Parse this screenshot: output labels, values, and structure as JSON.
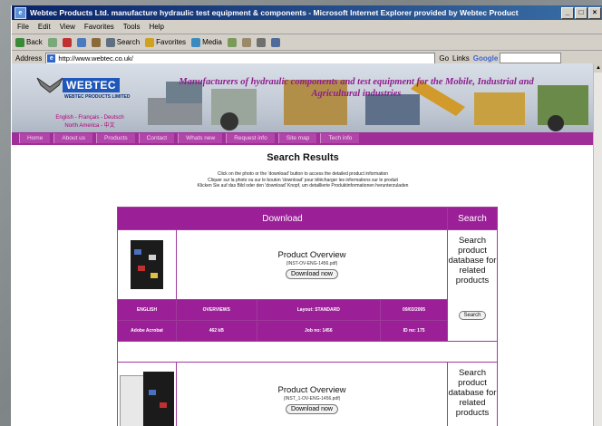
{
  "window": {
    "title": "Webtec Products Ltd. manufacture hydraulic test equipment & components - Microsoft Internet Explorer provided by Webtec Product"
  },
  "menu": [
    "File",
    "Edit",
    "View",
    "Favorites",
    "Tools",
    "Help"
  ],
  "toolbar": {
    "back": "Back",
    "search": "Search",
    "favorites": "Favorites",
    "media": "Media"
  },
  "address": {
    "label": "Address",
    "url": "http://www.webtec.co.uk/",
    "go": "Go",
    "links": "Links",
    "google": "Google"
  },
  "site": {
    "logo": "WEBTEC",
    "logo_sub": "WEBTEC PRODUCTS LIMITED",
    "languages": [
      "English - Français - Deutsch",
      "North America - 中文"
    ],
    "tagline": "Manufacturers of hydraulic components and test equipment for the Mobile, Industrial and Agricultural industries",
    "nav": [
      "Home",
      "About us",
      "Products",
      "Contact",
      "Whats new",
      "Request info",
      "Site map",
      "Tech info"
    ]
  },
  "results": {
    "heading": "Search Results",
    "instructions": [
      "Click on the photo or the 'download' button to access the detailed product information",
      "Cliquer sur la photo ou sur le bouton 'download' pour télécharger les informations sur le produit",
      "Klicken Sie auf das Bild oder den 'download' Knopf, um detaillierte Produktinformationen herunterzuladen"
    ],
    "col_download": "Download",
    "col_search": "Search",
    "search_text": "Search product database for related products",
    "search_button": "Search",
    "items": [
      {
        "title": "Product Overview",
        "code": "(INST-OV-ENG-1456.pdf)",
        "download": "Download now",
        "language": "ENGLISH",
        "category": "OVERVIEWS",
        "layout": "Layout: STANDARD",
        "date": "09/03/2005",
        "format": "Adobe Acrobat",
        "size": "462 kB",
        "job": "Job no: 1456",
        "id": "ID no: 175"
      },
      {
        "title": "Product Overview",
        "code": "(INST_1-OV-ENG-1456.pdf)",
        "download": "Download now"
      }
    ]
  }
}
